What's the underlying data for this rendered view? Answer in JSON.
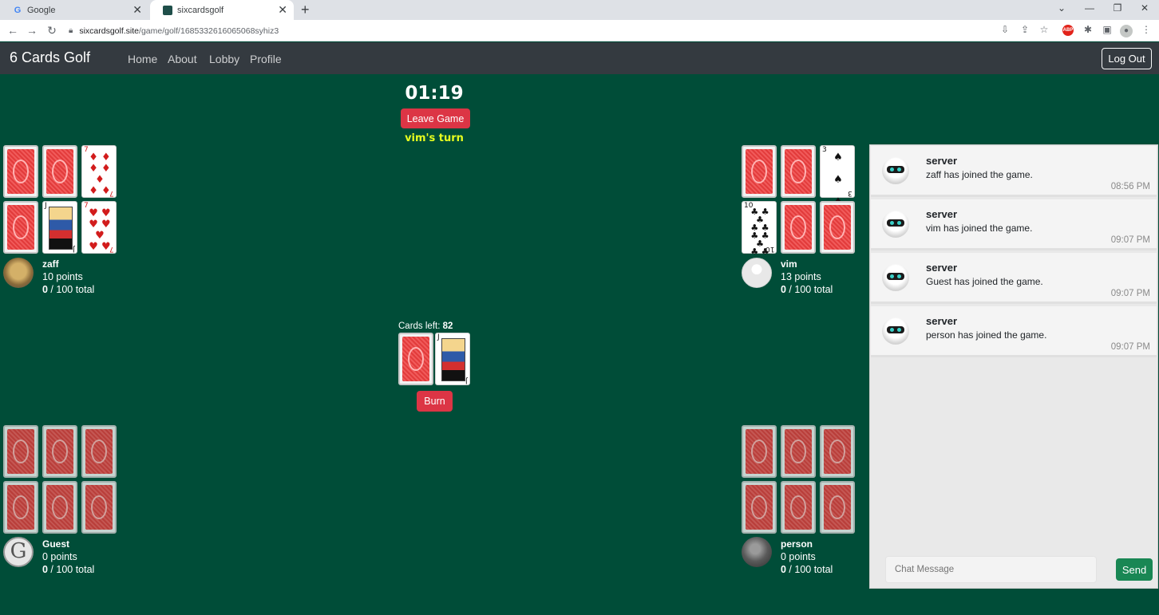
{
  "browser": {
    "tabs": [
      {
        "title": "Google",
        "icon": "google-g-icon"
      },
      {
        "title": "sixcardsgolf",
        "icon": "site-favicon"
      }
    ],
    "url_host": "sixcardsgolf.site",
    "url_path": "/game/golf/1685332616065068syhiz3"
  },
  "navbar": {
    "brand": "6 Cards Golf",
    "links": [
      "Home",
      "About",
      "Lobby",
      "Profile"
    ],
    "logout": "Log Out"
  },
  "game": {
    "timer": "01:19",
    "leave_label": "Leave Game",
    "turn_text": "vim's turn",
    "cards_left_label": "Cards left:",
    "cards_left": "82",
    "burn_label": "Burn"
  },
  "players": [
    {
      "name": "zaff",
      "points": "10 points",
      "total": "0",
      "total_suffix": " / 100 total",
      "cards": [
        "back",
        "back",
        "7 of diamonds",
        "back",
        "J of spades",
        "7 of hearts"
      ]
    },
    {
      "name": "vim",
      "points": "13 points",
      "total": "0",
      "total_suffix": " / 100 total",
      "cards": [
        "back",
        "back",
        "3 of spades",
        "10 of clubs",
        "back",
        "back"
      ]
    },
    {
      "name": "Guest",
      "points": "0 points",
      "total": "0",
      "total_suffix": " / 100 total",
      "cards": [
        "back",
        "back",
        "back",
        "back",
        "back",
        "back"
      ]
    },
    {
      "name": "person",
      "points": "0 points",
      "total": "0",
      "total_suffix": " / 100 total",
      "cards": [
        "back",
        "back",
        "back",
        "back",
        "back",
        "back"
      ]
    }
  ],
  "deck": {
    "draw_pile": "back",
    "discard_top": "J of spades"
  },
  "chat": {
    "messages": [
      {
        "sender": "server",
        "text": "zaff has joined the game.",
        "time": "08:56 PM"
      },
      {
        "sender": "server",
        "text": "vim has joined the game.",
        "time": "09:07 PM"
      },
      {
        "sender": "server",
        "text": "Guest has joined the game.",
        "time": "09:07 PM"
      },
      {
        "sender": "server",
        "text": "person has joined the game.",
        "time": "09:07 PM"
      }
    ],
    "input_placeholder": "Chat Message",
    "send_label": "Send"
  },
  "colors": {
    "table": "#004d38",
    "navbar": "#343a40",
    "danger": "#dc3545",
    "turn_highlight": "#e7ff1f",
    "send": "#198754"
  }
}
